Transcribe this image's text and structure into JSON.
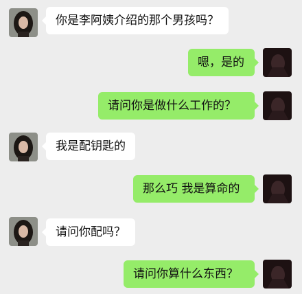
{
  "chat": {
    "messages": [
      {
        "sender": "other",
        "text": "你是李阿姨介绍的那个男孩吗？"
      },
      {
        "sender": "self",
        "text": "嗯，是的"
      },
      {
        "sender": "self",
        "text": "请问你是做什么工作的？"
      },
      {
        "sender": "other",
        "text": "我是配钥匙的"
      },
      {
        "sender": "self",
        "text": "那么巧 我是算命的"
      },
      {
        "sender": "other",
        "text": "请问你配吗？"
      },
      {
        "sender": "self",
        "text": "请问你算什么东西？"
      }
    ]
  },
  "colors": {
    "background": "#ededed",
    "incoming_bubble": "#ffffff",
    "outgoing_bubble": "#95ec69"
  },
  "icons": {
    "other_avatar": "girl-avatar-icon",
    "self_avatar": "dark-avatar-icon"
  }
}
